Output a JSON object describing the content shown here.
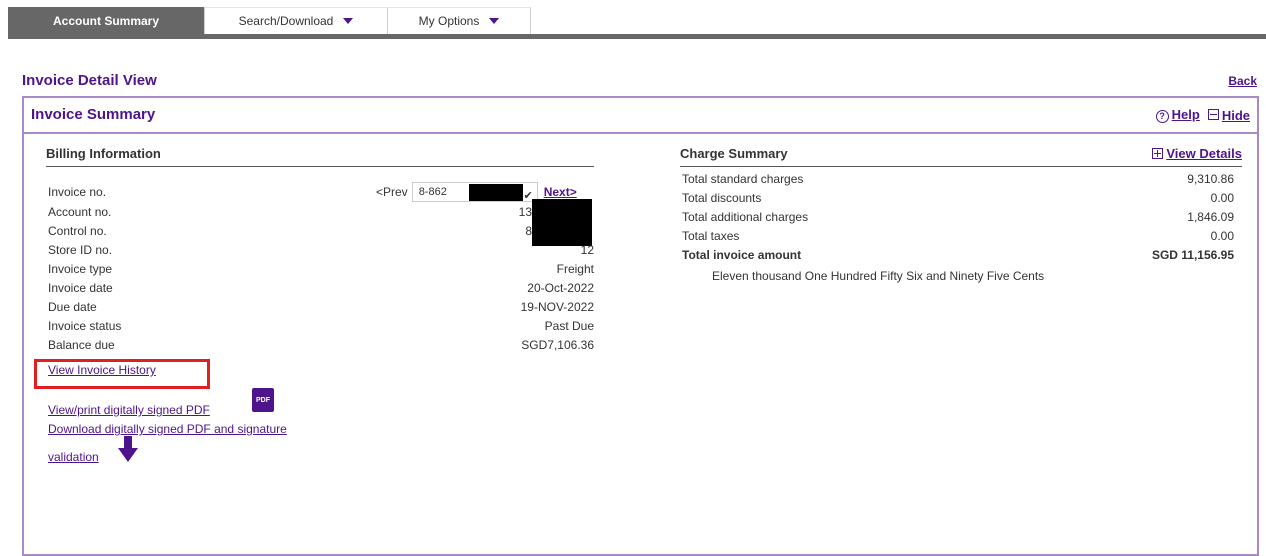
{
  "nav": {
    "tabs": [
      {
        "label": "Account Summary",
        "active": true
      },
      {
        "label": "Search/Download",
        "active": false
      },
      {
        "label": "My Options",
        "active": false
      }
    ]
  },
  "page": {
    "title": "Invoice Detail View",
    "back_label": "Back"
  },
  "panel": {
    "title": "Invoice Summary",
    "help_label": "Help",
    "hide_label": "Hide"
  },
  "billing": {
    "title": "Billing Information",
    "invoice_label": "Invoice no.",
    "prev_label": "<Prev",
    "invoice_value": "8-862",
    "next_label": "Next>",
    "rows": [
      {
        "label": "Account no.",
        "value": "13"
      },
      {
        "label": "Control no.",
        "value": "8"
      },
      {
        "label": "Store ID no.",
        "value": "12"
      },
      {
        "label": "Invoice type",
        "value": "Freight"
      },
      {
        "label": "Invoice date",
        "value": "20-Oct-2022"
      },
      {
        "label": "Due date",
        "value": "19-NOV-2022"
      },
      {
        "label": "Invoice status",
        "value": "Past Due"
      },
      {
        "label": "Balance due",
        "value": "SGD7,106.36"
      }
    ],
    "links": {
      "history": "View Invoice History",
      "view_pdf": "View/print digitally signed PDF",
      "download_pdf_line1": "Download digitally signed PDF and signature",
      "download_pdf_line2": "validation",
      "pdf_badge": "PDF"
    }
  },
  "charges": {
    "title": "Charge Summary",
    "view_details_label": "View Details",
    "rows": [
      {
        "label": "Total standard charges",
        "value": "9,310.86"
      },
      {
        "label": "Total discounts",
        "value": "0.00"
      },
      {
        "label": "Total additional charges",
        "value": "1,846.09"
      },
      {
        "label": "Total taxes",
        "value": "0.00"
      }
    ],
    "total": {
      "label": "Total invoice amount",
      "value": "SGD 11,156.95"
    },
    "amount_in_words": "Eleven thousand One Hundred Fifty Six and Ninety Five Cents"
  },
  "colors": {
    "brand_purple": "#4d148c",
    "panel_border": "#a98ac9",
    "active_tab": "#676767",
    "highlight_box": "#e02020"
  }
}
